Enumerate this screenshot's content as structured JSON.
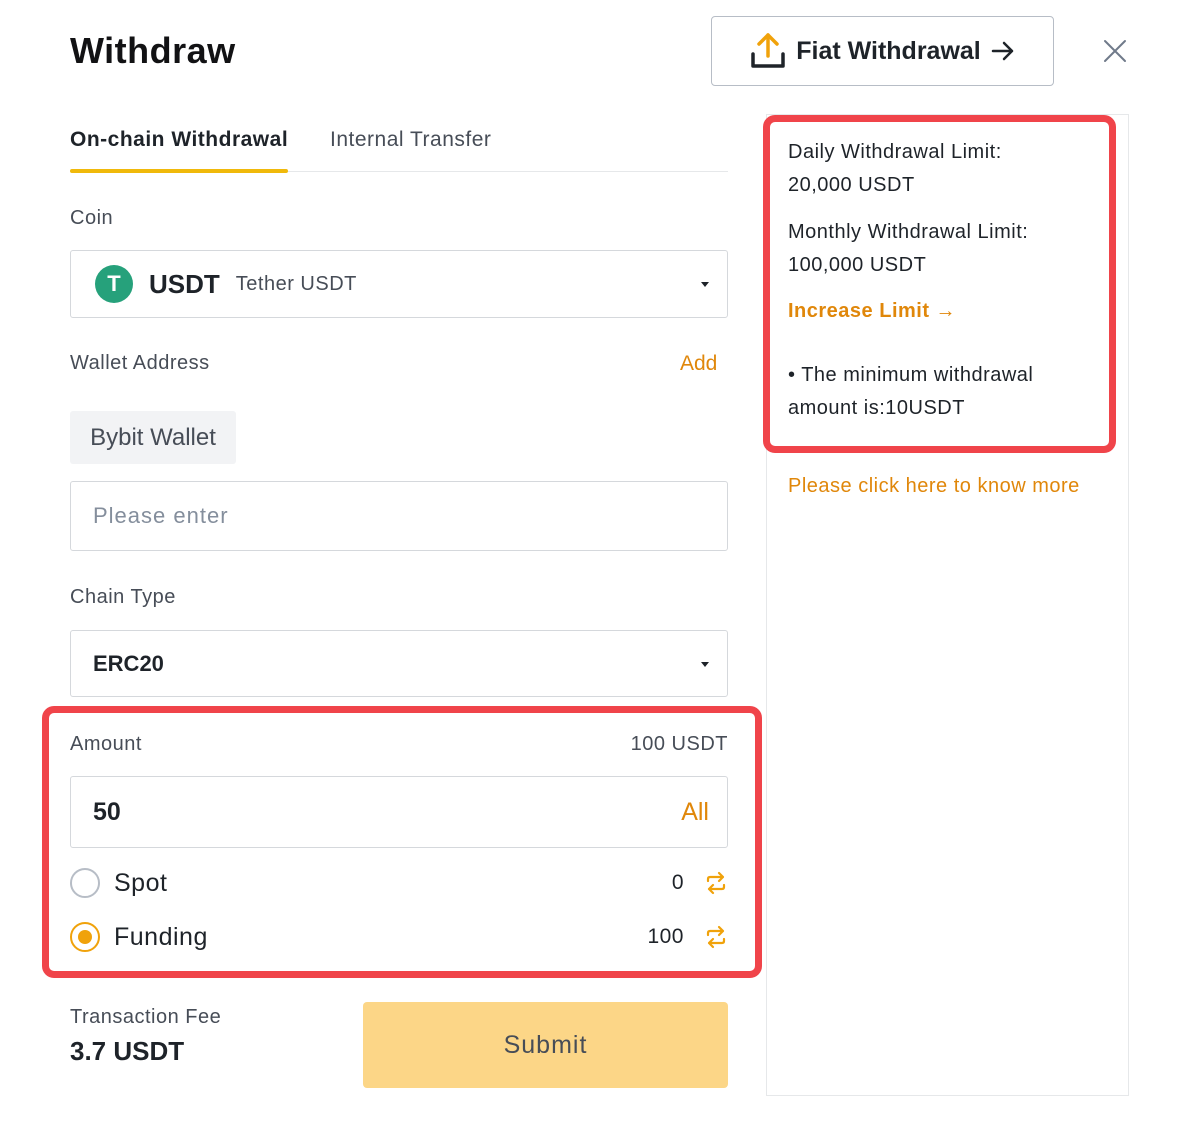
{
  "title": "Withdraw",
  "fiat_button": {
    "label": "Fiat Withdrawal",
    "icon": "upload-icon",
    "arrow_icon": "arrow-right-icon"
  },
  "close_icon": "close-icon",
  "tabs": [
    {
      "label": "On-chain Withdrawal",
      "active": true
    },
    {
      "label": "Internal Transfer",
      "active": false
    }
  ],
  "coin": {
    "label": "Coin",
    "icon_letter": "T",
    "symbol": "USDT",
    "name": "Tether USDT"
  },
  "wallet": {
    "label": "Wallet Address",
    "add_label": "Add",
    "chip_label": "Bybit Wallet",
    "placeholder": "Please enter"
  },
  "chain": {
    "label": "Chain Type",
    "value": "ERC20"
  },
  "amount": {
    "label": "Amount",
    "max": "100 USDT",
    "value": "50",
    "all_label": "All"
  },
  "accounts": [
    {
      "label": "Spot",
      "balance": "0",
      "selected": false
    },
    {
      "label": "Funding",
      "balance": "100",
      "selected": true
    }
  ],
  "fee": {
    "label": "Transaction Fee",
    "value": "3.7 USDT"
  },
  "submit_label": "Submit",
  "limits": {
    "daily_label": "Daily Withdrawal Limit:",
    "daily_value": "20,000 USDT",
    "monthly_label": "Monthly Withdrawal Limit:",
    "monthly_value": "100,000 USDT",
    "increase_label": "Increase Limit →",
    "min_line1": "• The minimum withdrawal",
    "min_line2": "amount is:10USDT"
  },
  "know_more": "Please click here to know more",
  "colors": {
    "accent": "#f0b90b",
    "link": "#e0870a",
    "highlight": "#f0444a",
    "submit_bg": "#fcd687"
  }
}
